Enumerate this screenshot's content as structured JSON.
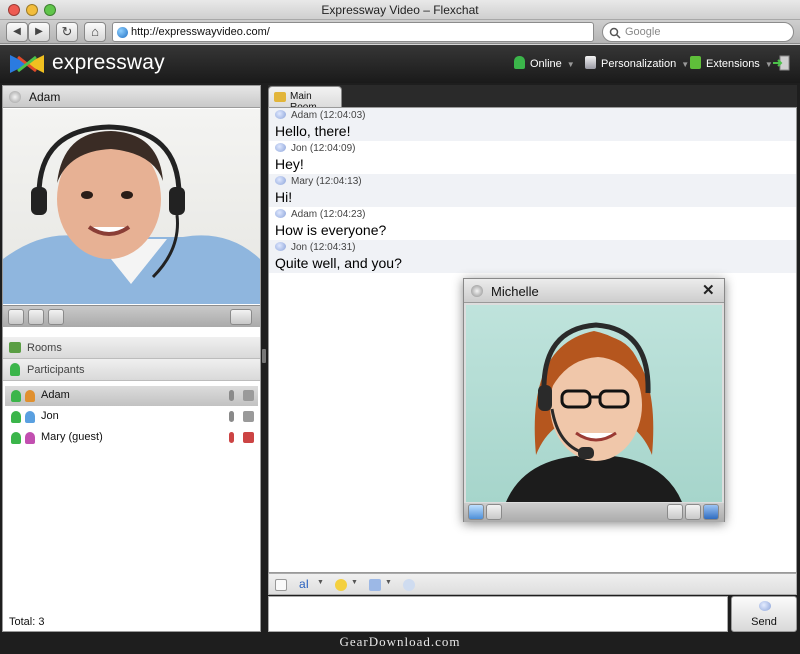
{
  "browser": {
    "title": "Expressway Video – Flexchat",
    "url": "http://expresswayvideo.com/",
    "search_placeholder": "Google",
    "back_glyph": "◀",
    "forward_glyph": "▶",
    "reload_glyph": "↻",
    "home_glyph": "⌂"
  },
  "app": {
    "logo": "expressway",
    "menu": {
      "online": "Online",
      "personalization": "Personalization",
      "extensions": "Extensions"
    }
  },
  "left_panel": {
    "user_name": "Adam",
    "rooms_label": "Rooms",
    "participants_label": "Participants",
    "participants": [
      {
        "name": "Adam"
      },
      {
        "name": "Jon"
      },
      {
        "name": "Mary (guest)"
      }
    ],
    "total": "Total: 3"
  },
  "chat": {
    "room_tab": "Main Room",
    "messages": [
      {
        "sender": "Adam (12:04:03)",
        "text": "Hello, there!"
      },
      {
        "sender": "Jon (12:04:09)",
        "text": "Hey!"
      },
      {
        "sender": "Mary (12:04:13)",
        "text": "Hi!"
      },
      {
        "sender": "Adam (12:04:23)",
        "text": "How is everyone?"
      },
      {
        "sender": "Jon (12:04:31)",
        "text": "Quite well, and you?"
      }
    ],
    "send_label": "Send",
    "font_tool_label": "aI"
  },
  "popup": {
    "name": "Michelle",
    "close_glyph": "✕"
  },
  "footer": "GearDownload.com",
  "colors": {
    "header_bg": "#1e1e1e",
    "online_green": "#3bb54a",
    "extensions_green": "#5fbf3a"
  }
}
